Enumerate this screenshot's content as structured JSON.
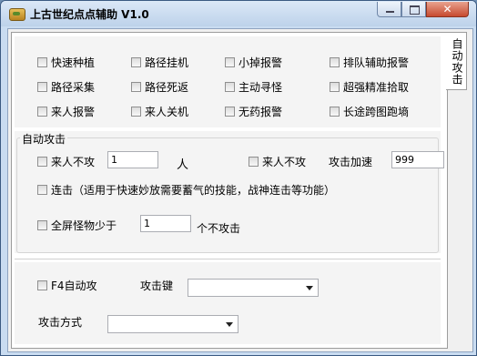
{
  "window": {
    "title": "上古世纪点点辅助 V1.0",
    "close_label": "✕"
  },
  "tab": {
    "label": "自动攻击"
  },
  "options": [
    {
      "label": "快速种植"
    },
    {
      "label": "路径挂机"
    },
    {
      "label": "小掉报警"
    },
    {
      "label": "排队辅助报警"
    },
    {
      "label": "路径采集"
    },
    {
      "label": "路径死返"
    },
    {
      "label": "主动寻怪"
    },
    {
      "label": "超强精准拾取"
    },
    {
      "label": "来人报警"
    },
    {
      "label": "来人关机"
    },
    {
      "label": "无药报警"
    },
    {
      "label": "长途跨图跑墒"
    }
  ],
  "auto_attack": {
    "group_title": "自动攻击",
    "no_attack_label": "来人不攻",
    "no_attack_value": "1",
    "person_unit": "人",
    "no_attack2_label": "来人不攻",
    "speed_label": "攻击加速",
    "speed_value": "999",
    "combo_label": "连击（适用于快速妙放需要蓄气的技能，战神连击等功能）",
    "fullscreen_label": "全屏怪物少于",
    "fullscreen_value": "1",
    "fullscreen_suffix": "个不攻击"
  },
  "f4": {
    "label": "F4自动攻",
    "key_label": "攻击键",
    "mode_label": "攻击方式"
  }
}
